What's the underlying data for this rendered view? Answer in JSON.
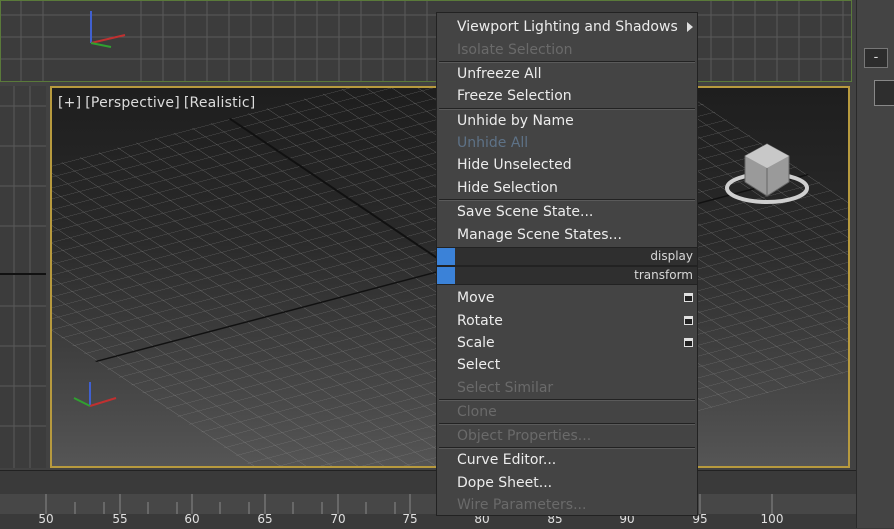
{
  "viewport": {
    "label_plus": "[+]",
    "label_view": "[Perspective]",
    "label_shading": "[Realistic]"
  },
  "side_panel": {
    "minus_label": "-"
  },
  "menu": {
    "items": [
      {
        "label": "Viewport Lighting and Shadows",
        "state": "normal",
        "submenu": true
      },
      {
        "label": "Isolate Selection",
        "state": "disabled"
      },
      {
        "label": "Unfreeze All",
        "state": "normal"
      },
      {
        "label": "Freeze Selection",
        "state": "normal"
      },
      {
        "label": "Unhide by Name",
        "state": "normal"
      },
      {
        "label": "Unhide All",
        "state": "dim"
      },
      {
        "label": "Hide Unselected",
        "state": "normal"
      },
      {
        "label": "Hide Selection",
        "state": "normal"
      },
      {
        "label": "Save Scene State...",
        "state": "normal"
      },
      {
        "label": "Manage Scene States...",
        "state": "normal"
      },
      {
        "label": "Move",
        "state": "normal",
        "options": true
      },
      {
        "label": "Rotate",
        "state": "normal",
        "options": true
      },
      {
        "label": "Scale",
        "state": "normal",
        "options": true
      },
      {
        "label": "Select",
        "state": "normal"
      },
      {
        "label": "Select Similar",
        "state": "disabled"
      },
      {
        "label": "Clone",
        "state": "disabled"
      },
      {
        "label": "Object Properties...",
        "state": "disabled"
      },
      {
        "label": "Curve Editor...",
        "state": "normal"
      },
      {
        "label": "Dope Sheet...",
        "state": "normal"
      },
      {
        "label": "Wire Parameters...",
        "state": "disabled"
      }
    ],
    "quad_headers": [
      "display",
      "transform"
    ]
  },
  "timeline": {
    "ticks": [
      "50",
      "55",
      "60",
      "65",
      "70",
      "75",
      "80",
      "85",
      "90",
      "95",
      "100"
    ]
  },
  "colors": {
    "active_border": "#b79a3e",
    "quad_accent": "#3b82d8"
  }
}
